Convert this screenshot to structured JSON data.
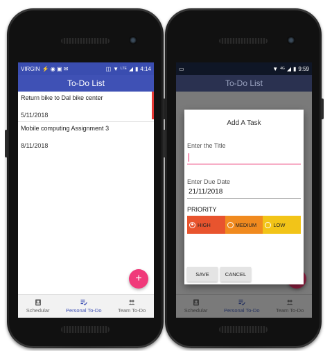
{
  "phone1": {
    "status": {
      "carrier": "VIRGIN",
      "time": "4:14",
      "network": "LTE"
    },
    "title": "To-Do List",
    "tasks": [
      {
        "title": "Return bike to Dal bike center",
        "date": "5/11/2018"
      },
      {
        "title": "Mobile computing Assignment 3",
        "date": "8/11/2018"
      }
    ],
    "fab_label": "+",
    "nav": [
      {
        "label": "Schedular"
      },
      {
        "label": "Personal To-Do"
      },
      {
        "label": "Team To-Do"
      }
    ]
  },
  "phone2": {
    "status": {
      "time": "9:59",
      "network": "4G"
    },
    "title": "To-Do List",
    "dialog": {
      "title": "Add A Task",
      "title_label": "Enter the Title",
      "title_value": "",
      "date_label": "Enter Due Date",
      "date_value": "21/11/2018",
      "priority_label": "PRIORITY",
      "priorities": [
        {
          "label": "HIGH",
          "selected": true,
          "color": "#e8542e"
        },
        {
          "label": "MEDIUM",
          "selected": false,
          "color": "#f08a1f"
        },
        {
          "label": "LOW",
          "selected": false,
          "color": "#f2c418"
        }
      ],
      "save_label": "SAVE",
      "cancel_label": "CANCEL"
    },
    "nav": [
      {
        "label": "Schedular"
      },
      {
        "label": "Personal To-Do"
      },
      {
        "label": "Team To-Do"
      }
    ]
  },
  "colors": {
    "primary": "#3f51b5",
    "accent": "#f03a7a"
  }
}
